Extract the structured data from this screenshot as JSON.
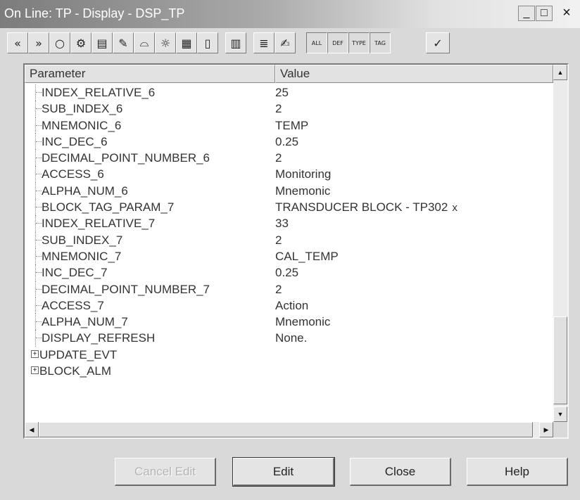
{
  "window": {
    "title": "On Line: TP - Display - DSP_TP",
    "minimize_glyph": "_",
    "maximize_glyph": "□",
    "close_glyph": "×"
  },
  "toolbar": {
    "buttons": [
      {
        "icon": "nav-first-icon",
        "glyph": "«"
      },
      {
        "icon": "nav-next-icon",
        "glyph": "»"
      },
      {
        "icon": "circle-icon",
        "glyph": "○"
      },
      {
        "icon": "gear-icon",
        "glyph": "⚙"
      },
      {
        "icon": "block-icon",
        "glyph": "▤"
      },
      {
        "icon": "wrench-icon",
        "glyph": "✎"
      },
      {
        "icon": "dome-icon",
        "glyph": "⌓"
      },
      {
        "icon": "bulb-icon",
        "glyph": "☼"
      },
      {
        "icon": "calculator-icon",
        "glyph": "▦"
      },
      {
        "icon": "document-icon",
        "glyph": "▯"
      },
      {
        "icon": "dmf-icon",
        "glyph": "▥"
      },
      {
        "icon": "list-icon",
        "glyph": "≣"
      },
      {
        "icon": "write-icon",
        "glyph": "✍"
      },
      {
        "icon": "all-icon",
        "glyph": "ALL"
      },
      {
        "icon": "def-icon",
        "glyph": "DEF"
      },
      {
        "icon": "type-icon",
        "glyph": "TYPE"
      },
      {
        "icon": "tag-icon",
        "glyph": "TAG"
      },
      {
        "icon": "check-icon",
        "glyph": "✓"
      }
    ]
  },
  "table": {
    "columns": [
      "Parameter",
      "Value"
    ],
    "rows": [
      {
        "name": "INDEX_RELATIVE_6",
        "value": "25"
      },
      {
        "name": "SUB_INDEX_6",
        "value": "2"
      },
      {
        "name": "MNEMONIC_6",
        "value": "TEMP"
      },
      {
        "name": "INC_DEC_6",
        "value": "0.25"
      },
      {
        "name": "DECIMAL_POINT_NUMBER_6",
        "value": "2"
      },
      {
        "name": "ACCESS_6",
        "value": "Monitoring"
      },
      {
        "name": "ALPHA_NUM_6",
        "value": "Mnemonic"
      },
      {
        "name": "BLOCK_TAG_PARAM_7",
        "value": "TRANSDUCER BLOCK - TP302",
        "mark": "x"
      },
      {
        "name": "INDEX_RELATIVE_7",
        "value": "33"
      },
      {
        "name": "SUB_INDEX_7",
        "value": "2"
      },
      {
        "name": "MNEMONIC_7",
        "value": "CAL_TEMP"
      },
      {
        "name": "INC_DEC_7",
        "value": "0.25"
      },
      {
        "name": "DECIMAL_POINT_NUMBER_7",
        "value": "2"
      },
      {
        "name": "ACCESS_7",
        "value": "Action"
      },
      {
        "name": "ALPHA_NUM_7",
        "value": "Mnemonic"
      },
      {
        "name": "DISPLAY_REFRESH",
        "value": "None."
      }
    ],
    "groups": [
      {
        "name": "UPDATE_EVT",
        "expander": "+"
      },
      {
        "name": "BLOCK_ALM",
        "expander": "+"
      }
    ]
  },
  "scrollbar": {
    "up": "▲",
    "down": "▼",
    "left": "◀",
    "right": "▶"
  },
  "buttons": {
    "cancel_edit": "Cancel Edit",
    "edit": "Edit",
    "close": "Close",
    "help": "Help"
  }
}
